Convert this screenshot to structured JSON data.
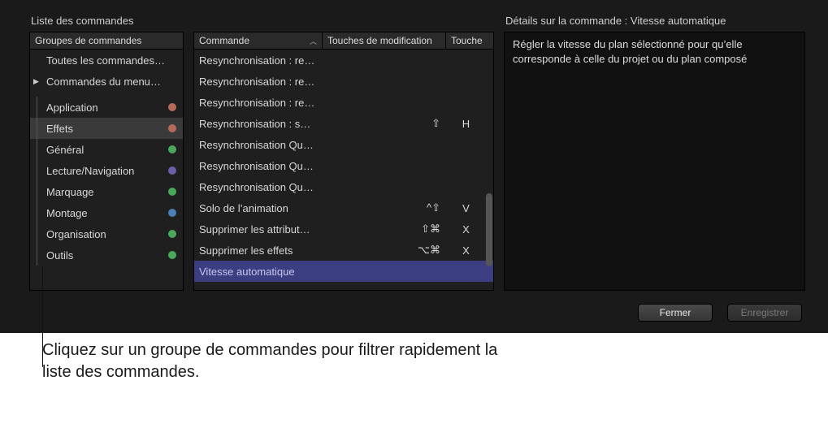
{
  "section_titles": {
    "list": "Liste des commandes",
    "details_prefix": "Détails sur la commande : ",
    "details_cmd": "Vitesse automatique"
  },
  "headers": {
    "groups": "Groupes de commandes",
    "command": "Commande",
    "modifiers": "Touches de modification",
    "key": "Touche"
  },
  "groups_top": [
    {
      "label": "Toutes les commandes…",
      "disclosure": false
    },
    {
      "label": "Commandes du menu…",
      "disclosure": true
    }
  ],
  "groups": [
    {
      "label": "Application",
      "color": "#b66b5a",
      "selected": false
    },
    {
      "label": "Effets",
      "color": "#b66b5a",
      "selected": true
    },
    {
      "label": "Général",
      "color": "#4aa85a",
      "selected": false
    },
    {
      "label": "Lecture/Navigation",
      "color": "#6b5fa8",
      "selected": false
    },
    {
      "label": "Marquage",
      "color": "#4aa85a",
      "selected": false
    },
    {
      "label": "Montage",
      "color": "#4a7fb8",
      "selected": false
    },
    {
      "label": "Organisation",
      "color": "#4aa85a",
      "selected": false
    },
    {
      "label": "Outils",
      "color": "#4aa85a",
      "selected": false
    }
  ],
  "commands": [
    {
      "name": "Resynchronisation : re…",
      "mod": "",
      "key": ""
    },
    {
      "name": "Resynchronisation : re…",
      "mod": "",
      "key": ""
    },
    {
      "name": "Resynchronisation : re…",
      "mod": "",
      "key": ""
    },
    {
      "name": "Resynchronisation : s…",
      "mod": "⇧",
      "key": "H"
    },
    {
      "name": "Resynchronisation Qu…",
      "mod": "",
      "key": ""
    },
    {
      "name": "Resynchronisation Qu…",
      "mod": "",
      "key": ""
    },
    {
      "name": "Resynchronisation Qu…",
      "mod": "",
      "key": ""
    },
    {
      "name": "Solo de l’animation",
      "mod": "^⇧",
      "key": "V"
    },
    {
      "name": "Supprimer les attribut…",
      "mod": "⇧⌘",
      "key": "X"
    },
    {
      "name": "Supprimer les effets",
      "mod": "⌥⌘",
      "key": "X"
    },
    {
      "name": "Vitesse automatique",
      "mod": "",
      "key": "",
      "selected": true
    }
  ],
  "details_text": "Régler la vitesse du plan sélectionné pour qu’elle corresponde à celle du projet ou du plan composé",
  "buttons": {
    "close": "Fermer",
    "save": "Enregistrer"
  },
  "callout": "Cliquez sur un groupe de commandes pour filtrer rapidement la liste des commandes."
}
